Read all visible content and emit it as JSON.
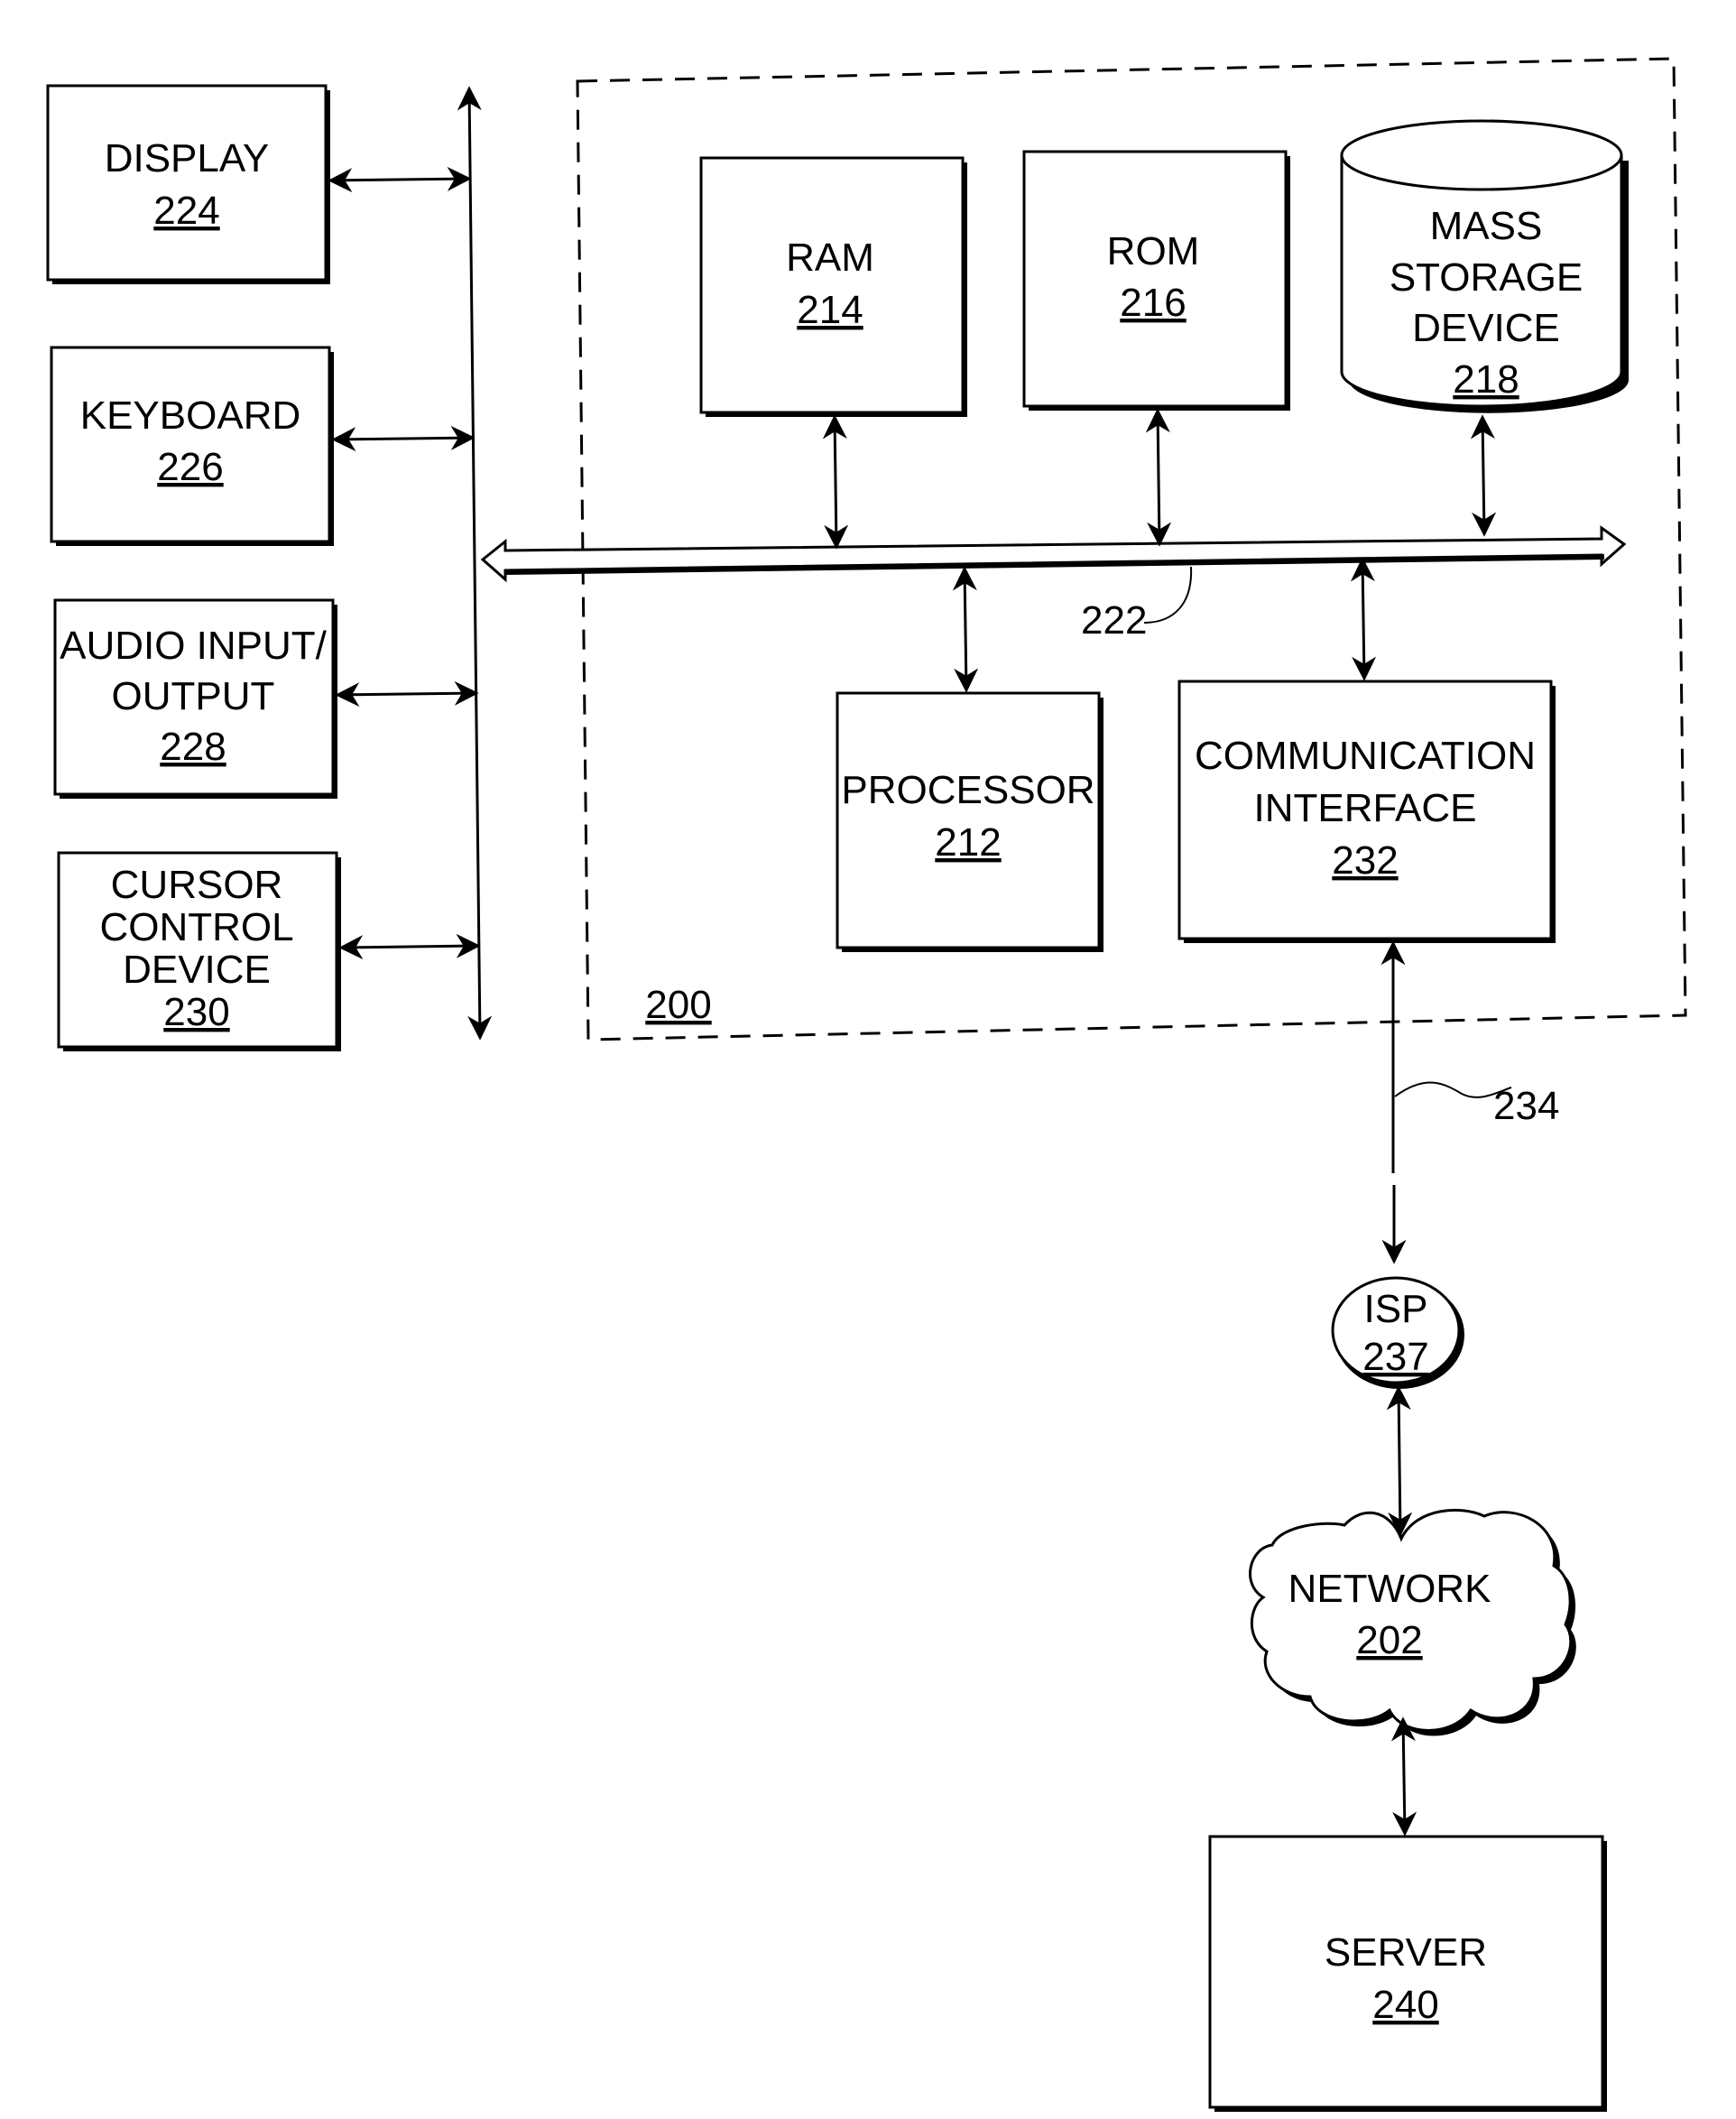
{
  "diagram": {
    "system_label": "200",
    "bus_label": "222",
    "link_label": "234",
    "components": {
      "display": {
        "name": "DISPLAY",
        "ref": "224"
      },
      "keyboard": {
        "name": "KEYBOARD",
        "ref": "226"
      },
      "audio": {
        "name_line1": "AUDIO INPUT/",
        "name_line2": "OUTPUT",
        "ref": "228"
      },
      "cursor": {
        "name_line1": "CURSOR",
        "name_line2": "CONTROL",
        "name_line3": "DEVICE",
        "ref": "230"
      },
      "ram": {
        "name": "RAM",
        "ref": "214"
      },
      "rom": {
        "name": "ROM",
        "ref": "216"
      },
      "mass_storage": {
        "name_line1": "MASS",
        "name_line2": "STORAGE",
        "name_line3": "DEVICE",
        "ref": "218"
      },
      "processor": {
        "name": "PROCESSOR",
        "ref": "212"
      },
      "comm_interface": {
        "name_line1": "COMMUNICATION",
        "name_line2": "INTERFACE",
        "ref": "232"
      },
      "isp": {
        "name": "ISP",
        "ref": "237"
      },
      "network": {
        "name": "NETWORK",
        "ref": "202"
      },
      "server": {
        "name": "SERVER",
        "ref": "240"
      }
    }
  }
}
